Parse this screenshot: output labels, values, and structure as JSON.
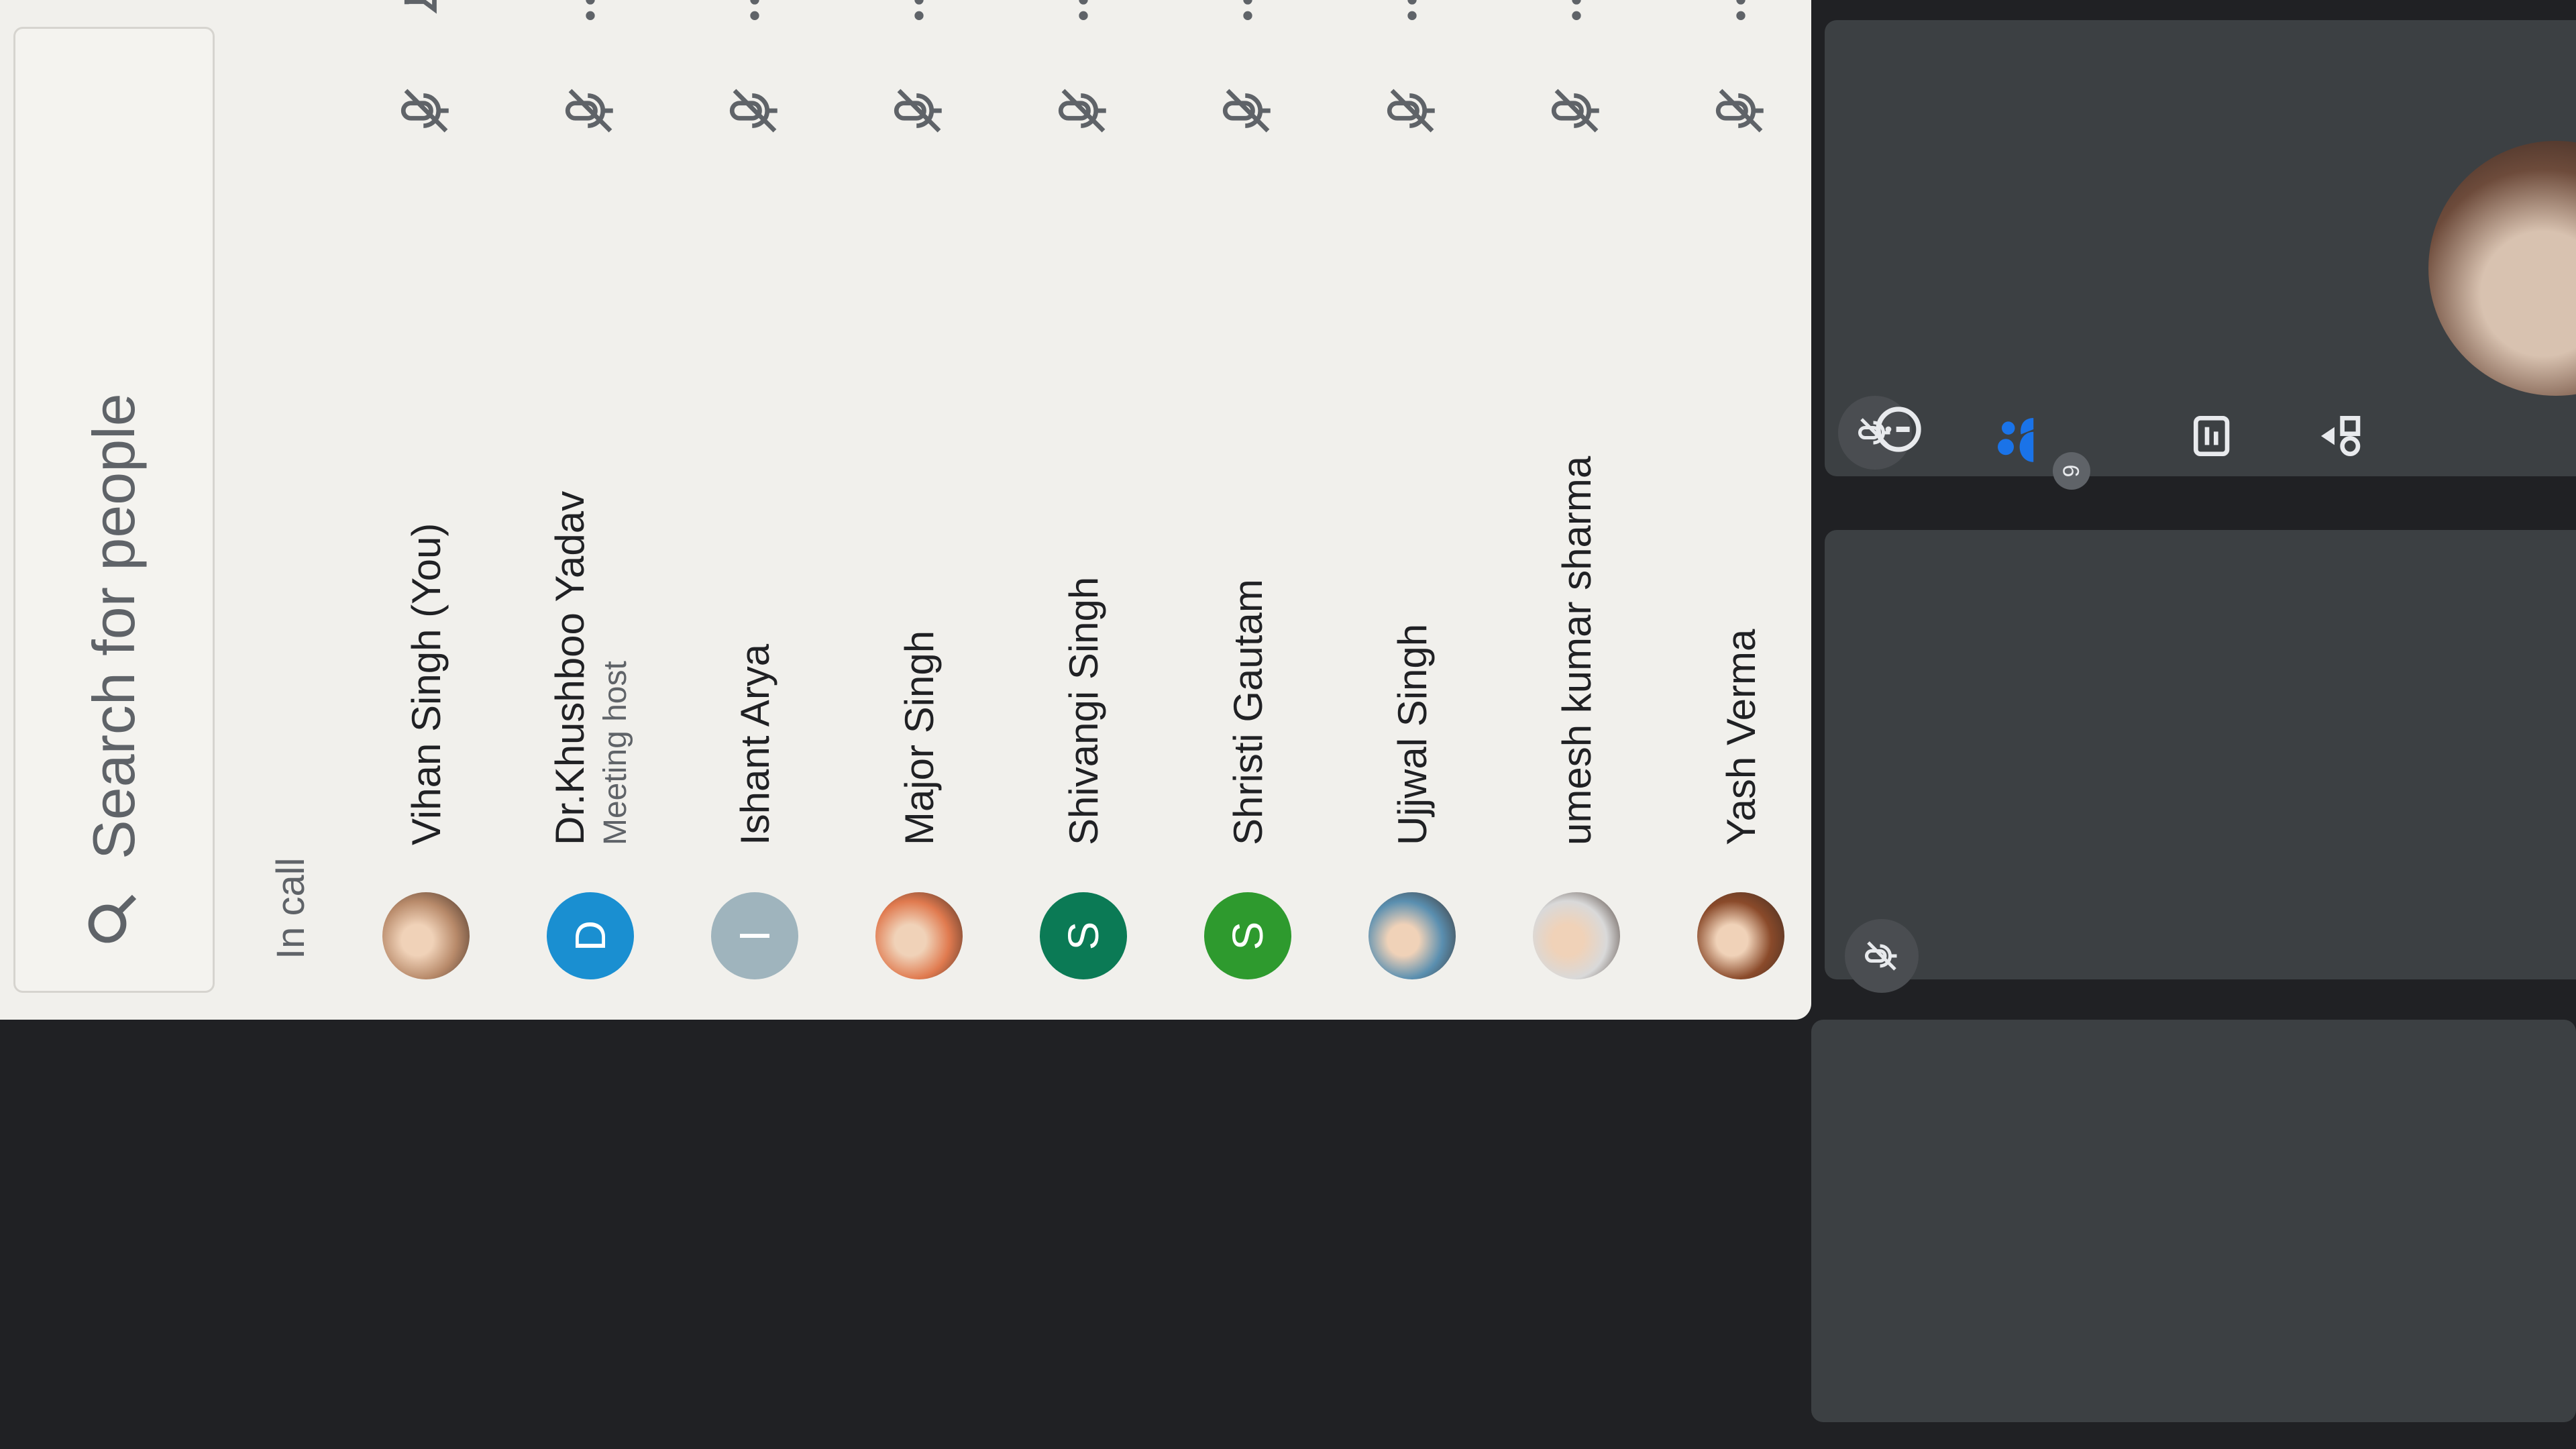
{
  "search": {
    "placeholder": "Search for people"
  },
  "panel": {
    "section_label": "In call",
    "participants": [
      {
        "name": "Vihan Singh (You)",
        "role": "",
        "initial": "",
        "avatar_color": "#b88a6a",
        "photo": true,
        "action_icon": "pin-icon"
      },
      {
        "name": "Dr.Khushboo Yadav",
        "role": "Meeting host",
        "initial": "D",
        "avatar_color": "#1a8fd1",
        "photo": false,
        "action_icon": "more-icon"
      },
      {
        "name": "Ishant Arya",
        "role": "",
        "initial": "I",
        "avatar_color": "#9fb4bd",
        "photo": false,
        "action_icon": "more-icon"
      },
      {
        "name": "Major Singh",
        "role": "",
        "initial": "",
        "avatar_color": "#e07a4f",
        "photo": true,
        "action_icon": "more-icon"
      },
      {
        "name": "Shivangi Singh",
        "role": "",
        "initial": "S",
        "avatar_color": "#0b7a55",
        "photo": false,
        "action_icon": "more-icon"
      },
      {
        "name": "Shristi Gautam",
        "role": "",
        "initial": "S",
        "avatar_color": "#2e9a2e",
        "photo": false,
        "action_icon": "more-icon"
      },
      {
        "name": "Ujjwal Singh",
        "role": "",
        "initial": "",
        "avatar_color": "#5a8fb0",
        "photo": true,
        "action_icon": "more-icon"
      },
      {
        "name": "umesh kumar sharma",
        "role": "",
        "initial": "",
        "avatar_color": "#d9d9d9",
        "photo": true,
        "action_icon": "more-icon"
      },
      {
        "name": "Yash Verma",
        "role": "",
        "initial": "",
        "avatar_color": "#8a4a2a",
        "photo": true,
        "action_icon": "more-icon"
      }
    ]
  },
  "toolbar": {
    "people_count": "9",
    "icons": [
      "info-icon",
      "people-icon",
      "chat-icon",
      "activities-icon"
    ],
    "accent": "#1a73e8"
  }
}
